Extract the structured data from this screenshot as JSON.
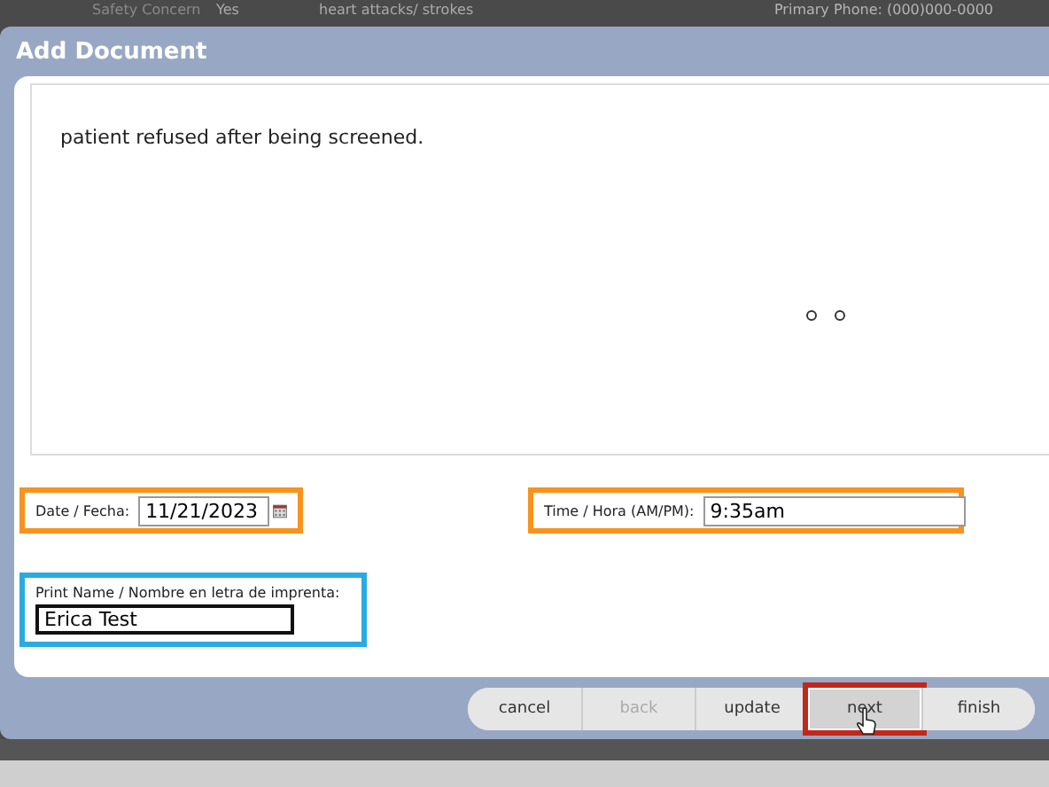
{
  "background": {
    "texts": [
      "Safety Concern",
      "Yes",
      "heart attacks/ strokes",
      "Primary Phone: (000)000-0000"
    ]
  },
  "dialog": {
    "title": "Add Document",
    "note": "patient refused after being screened.",
    "fields": [
      {
        "kind": "date",
        "label": "Date / Fecha:",
        "value": "11/21/2023",
        "color": "#f7931e"
      },
      {
        "kind": "text",
        "label": "Time / Hora (AM/PM):",
        "value": "9:35am",
        "color": "#f7931e"
      },
      {
        "kind": "stacked",
        "label": "Print Name / Nombre en letra de imprenta:",
        "value": "Erica Test",
        "color": "#29abe2"
      }
    ],
    "buttons": [
      {
        "label": "cancel",
        "disabled": false,
        "highlighted": false
      },
      {
        "label": "back",
        "disabled": true,
        "highlighted": false
      },
      {
        "label": "update",
        "disabled": false,
        "highlighted": false
      },
      {
        "label": "next",
        "disabled": false,
        "highlighted": true
      },
      {
        "label": "finish",
        "disabled": false,
        "highlighted": false
      }
    ]
  }
}
